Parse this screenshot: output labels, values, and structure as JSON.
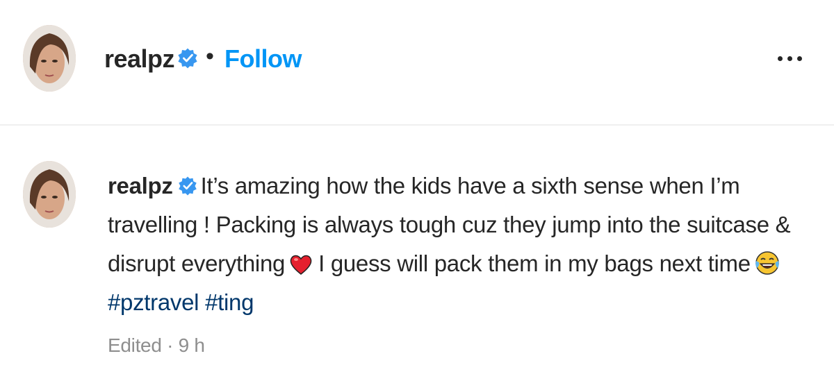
{
  "header": {
    "username": "realpz",
    "separator": "•",
    "follow_label": "Follow",
    "more_icon": "more-horizontal-icon"
  },
  "comment": {
    "username": "realpz",
    "text_part1": "It’s amazing how the kids have a sixth sense when I’m travelling ! Packing is always tough cuz they jump into the suitcase & disrupt everything",
    "text_part2": "I guess will pack them in my bags next time",
    "hashtags": [
      "#pztravel",
      "#ting"
    ],
    "edited_label": "Edited",
    "meta_separator": "·",
    "time": "9 h"
  },
  "colors": {
    "accent": "#0095f6",
    "hashtag": "#00376b",
    "verified": "#3897f0",
    "muted": "#8e8e8e"
  }
}
